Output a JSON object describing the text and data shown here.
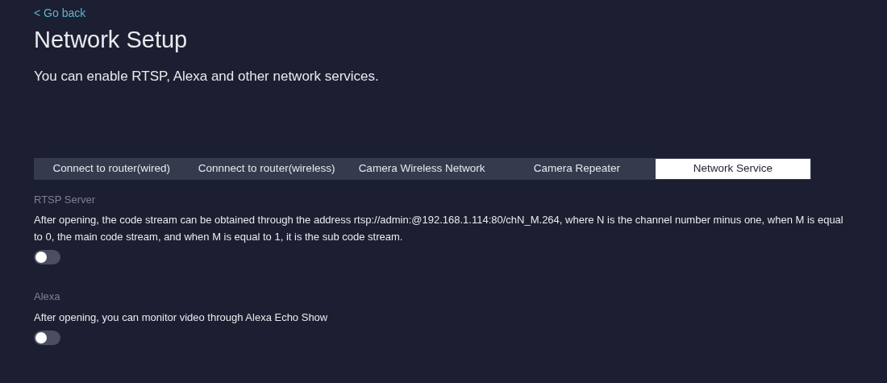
{
  "back_link": "< Go back",
  "title": "Network Setup",
  "subtitle": "You can enable RTSP, Alexa and other network services.",
  "tabs": [
    {
      "label": "Connect to router(wired)",
      "selected": false
    },
    {
      "label": "Connnect to router(wireless)",
      "selected": false
    },
    {
      "label": "Camera Wireless Network",
      "selected": false
    },
    {
      "label": "Camera Repeater",
      "selected": false
    },
    {
      "label": "Network Service",
      "selected": true
    }
  ],
  "services": [
    {
      "name": "RTSP Server",
      "description": "After opening, the code stream can be obtained through the address rtsp://admin:@192.168.1.114:80/chN_M.264, where N is the channel number minus one, when M is equal to 0, the main code stream, and when M is equal to 1, it is the sub code stream.",
      "on": false
    },
    {
      "name": "Alexa",
      "description": "After opening, you can monitor video through Alexa Echo Show",
      "on": false
    }
  ]
}
